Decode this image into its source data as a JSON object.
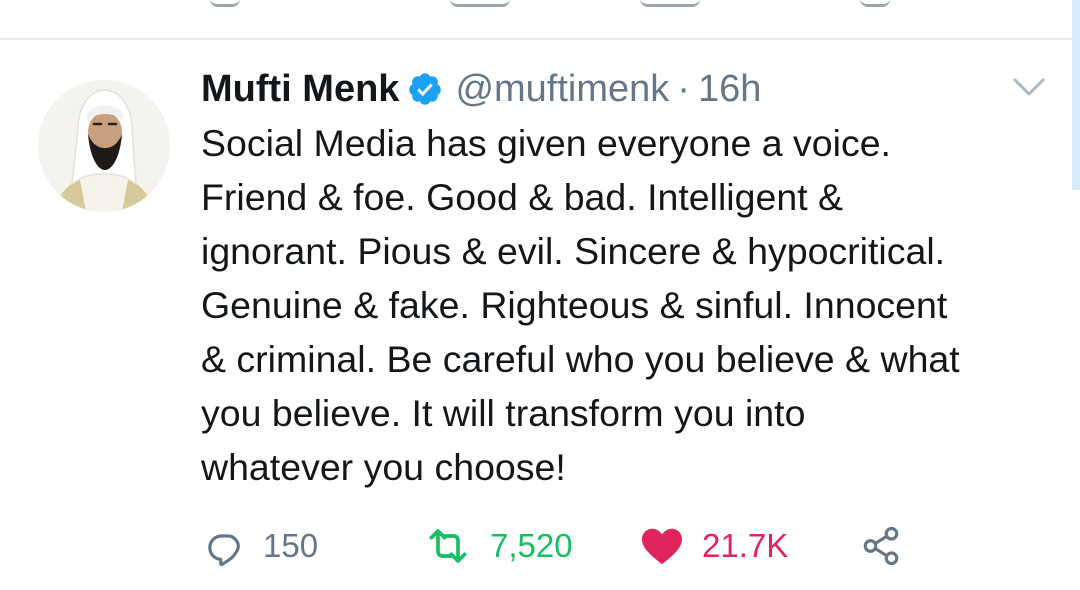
{
  "tweet": {
    "author_name": "Mufti Menk",
    "handle": "@muftimenk",
    "separator": "·",
    "time": "16h",
    "body_lines": [
      "Social Media has given everyone a voice.",
      "Friend & foe. Good & bad. Intelligent &",
      "ignorant. Pious & evil. Sincere & hypocritical.",
      "Genuine & fake. Righteous & sinful. Innocent",
      "& criminal. Be careful who you believe & what",
      "you believe. It will transform you into",
      "whatever you choose!"
    ],
    "stats": {
      "replies": "150",
      "retweets": "7,520",
      "likes": "21.7K"
    }
  },
  "icons": {
    "verified": "verified-badge-icon",
    "menu": "chevron-down-icon",
    "reply": "reply-icon",
    "retweet": "retweet-icon",
    "like": "heart-icon",
    "share": "share-icon"
  },
  "colors": {
    "verified_blue": "#1da1f2",
    "retweet_green": "#17bf63",
    "like_red": "#e0245e",
    "muted_gray": "#657786",
    "text": "#14171a"
  }
}
